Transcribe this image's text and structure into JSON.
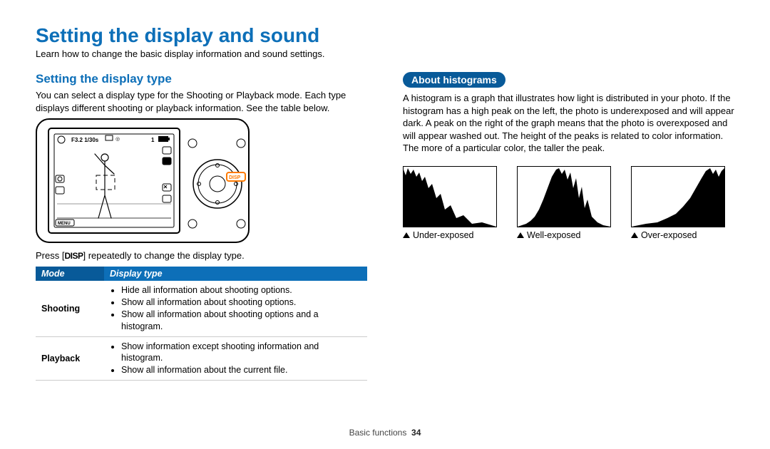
{
  "title": "Setting the display and sound",
  "intro": "Learn how to change the basic display information and sound settings.",
  "left": {
    "subtitle": "Setting the display type",
    "para": "You can select a display type for the Shooting or Playback mode. Each type displays different shooting or playback information. See the table below.",
    "press_prefix": "Press [",
    "press_button": "DISP",
    "press_suffix": "] repeatedly to change the display type.",
    "camera": {
      "aperture": "F3.2",
      "shutter": "1/30s",
      "count": "1",
      "menu_label": "MENU",
      "disp_label": "DISP"
    },
    "table": {
      "headers": {
        "mode": "Mode",
        "type": "Display type"
      },
      "rows": [
        {
          "mode": "Shooting",
          "items": [
            "Hide all information about shooting options.",
            "Show all information about shooting options.",
            "Show all information about shooting options and a histogram."
          ]
        },
        {
          "mode": "Playback",
          "items": [
            "Show information except shooting information and histogram.",
            "Show all information about the current file."
          ]
        }
      ]
    }
  },
  "right": {
    "pill": "About histograms",
    "para": "A histogram is a graph that illustrates how light is distributed in your photo. If the histogram has a high peak on the left, the photo is underexposed and will appear dark. A peak on the right of the graph means that the photo is overexposed and will appear washed out. The height of the peaks is related to color information. The more of a particular color, the taller the peak.",
    "hist": {
      "under": "Under-exposed",
      "well": "Well-exposed",
      "over": "Over-exposed"
    }
  },
  "footer": {
    "section": "Basic functions",
    "page": "34"
  }
}
